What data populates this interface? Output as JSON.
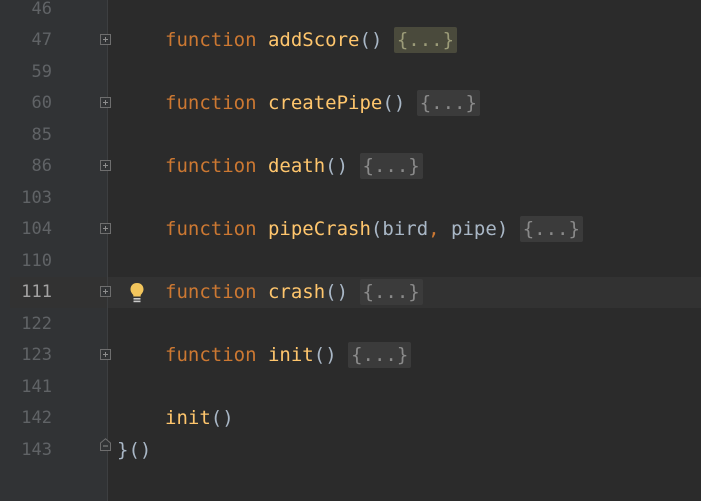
{
  "editor": {
    "lines": [
      {
        "number": "46"
      },
      {
        "number": "47",
        "keyword": "function",
        "name": "addScore",
        "params_open": "(",
        "params_close": ")",
        "placeholder": "{...}"
      },
      {
        "number": "59"
      },
      {
        "number": "60",
        "keyword": "function",
        "name": "createPipe",
        "params_open": "(",
        "params_close": ")",
        "placeholder": "{...}"
      },
      {
        "number": "85"
      },
      {
        "number": "86",
        "keyword": "function",
        "name": "death",
        "params_open": "(",
        "params_close": ")",
        "placeholder": "{...}"
      },
      {
        "number": "103"
      },
      {
        "number": "104",
        "keyword": "function",
        "name": "pipeCrash",
        "params_open": "(",
        "param1": "bird",
        "comma": ",",
        "param2": "pipe",
        "params_close": ")",
        "placeholder": "{...}"
      },
      {
        "number": "110"
      },
      {
        "number": "111",
        "keyword": "function",
        "name": "crash",
        "params_open": "(",
        "params_close": ")",
        "placeholder": "{...}"
      },
      {
        "number": "122"
      },
      {
        "number": "123",
        "keyword": "function",
        "name": "init",
        "params_open": "(",
        "params_close": ")",
        "placeholder": "{...}"
      },
      {
        "number": "141"
      },
      {
        "number": "142",
        "call": "init",
        "call_parens": "()"
      },
      {
        "number": "143",
        "closing": "}",
        "closing_call": "()"
      }
    ]
  },
  "colors": {
    "background": "#2b2b2b",
    "gutter": "#313335",
    "keyword": "#cc7832",
    "function_name": "#ffc66d",
    "text": "#a9b7c6",
    "line_number": "#606366",
    "current_line": "#323232",
    "bulb": "#f2c55c"
  },
  "icons": {
    "fold": "fold-plus-icon",
    "fold_end": "fold-end-icon",
    "intention": "lightbulb-icon"
  }
}
